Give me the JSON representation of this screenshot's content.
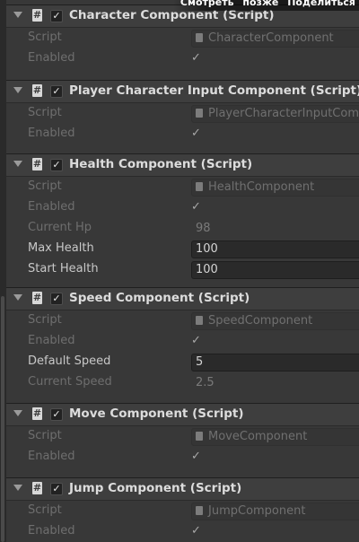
{
  "overlay": {
    "watch_later": "Смотреть позже",
    "share": "Поделиться"
  },
  "components": [
    {
      "title": "Character Component (Script)",
      "enabled": true,
      "fields": [
        {
          "label": "Script",
          "value": "CharacterComponent",
          "kind": "script"
        },
        {
          "label": "Enabled",
          "kind": "check"
        }
      ]
    },
    {
      "title": "Player Character Input Component (Script)",
      "enabled": true,
      "fields": [
        {
          "label": "Script",
          "value": "PlayerCharacterInputComp",
          "kind": "script"
        },
        {
          "label": "Enabled",
          "kind": "check"
        }
      ]
    },
    {
      "title": "Health Component (Script)",
      "enabled": true,
      "fields": [
        {
          "label": "Script",
          "value": "HealthComponent",
          "kind": "script"
        },
        {
          "label": "Enabled",
          "kind": "check"
        },
        {
          "label": "Current Hp",
          "value": "98",
          "kind": "readonly"
        },
        {
          "label": "Max Health",
          "value": "100",
          "kind": "editable"
        },
        {
          "label": "Start Health",
          "value": "100",
          "kind": "editable"
        }
      ]
    },
    {
      "title": "Speed Component (Script)",
      "enabled": true,
      "fields": [
        {
          "label": "Script",
          "value": "SpeedComponent",
          "kind": "script"
        },
        {
          "label": "Enabled",
          "kind": "check"
        },
        {
          "label": "Default Speed",
          "value": "5",
          "kind": "editable"
        },
        {
          "label": "Current Speed",
          "value": "2.5",
          "kind": "readonly"
        }
      ]
    },
    {
      "title": "Move Component (Script)",
      "enabled": true,
      "fields": [
        {
          "label": "Script",
          "value": "MoveComponent",
          "kind": "script"
        },
        {
          "label": "Enabled",
          "kind": "check"
        }
      ]
    },
    {
      "title": "Jump Component (Script)",
      "enabled": true,
      "fields": [
        {
          "label": "Script",
          "value": "JumpComponent",
          "kind": "script"
        },
        {
          "label": "Enabled",
          "kind": "check"
        }
      ]
    }
  ],
  "icons": {
    "foldout": "foldout-arrow-icon",
    "script": "script-icon",
    "check": "checkmark-icon",
    "file": "script-file-icon"
  }
}
